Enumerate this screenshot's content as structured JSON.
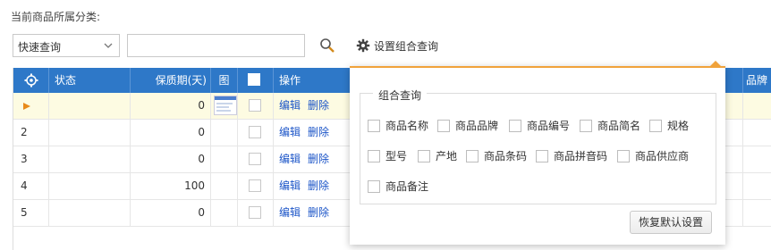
{
  "caption": "当前商品所属分类:",
  "search": {
    "mode_selected": "快速查询",
    "input_value": "",
    "settings_label": "设置组合查询"
  },
  "grid": {
    "columns": [
      "状态",
      "保质期(天)",
      "图",
      "操作",
      "品牌"
    ],
    "action_edit": "编辑",
    "action_delete": "删除",
    "rows": [
      {
        "no": "",
        "shelf_life": "0"
      },
      {
        "no": "2",
        "shelf_life": "0"
      },
      {
        "no": "3",
        "shelf_life": "0"
      },
      {
        "no": "4",
        "shelf_life": "100"
      },
      {
        "no": "5",
        "shelf_life": "0"
      }
    ]
  },
  "popover": {
    "legend": "组合查询",
    "options": [
      "商品名称",
      "商品品牌",
      "商品编号",
      "商品简名",
      "规格",
      "型号",
      "产地",
      "商品条码",
      "商品拼音码",
      "商品供应商",
      "商品备注"
    ],
    "reset_label": "恢复默认设置"
  },
  "colors": {
    "header_bg": "#2e78c8",
    "accent_orange": "#f0a23a",
    "link_blue": "#1d56c8",
    "selected_row": "#fdfbe2"
  }
}
